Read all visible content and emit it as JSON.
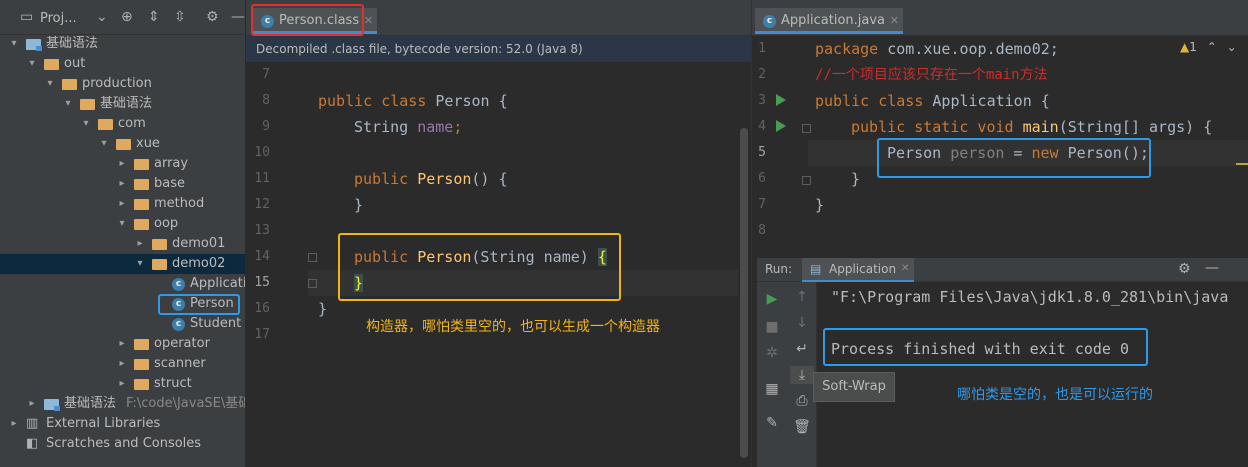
{
  "project_panel": {
    "title": "Proj...",
    "tree": [
      {
        "label": "基础语法",
        "icon": "module-folder-icon",
        "expanded": true
      },
      {
        "label": "out",
        "icon": "folder-icon",
        "expanded": true
      },
      {
        "label": "production",
        "icon": "folder-icon",
        "expanded": true
      },
      {
        "label": "基础语法",
        "icon": "folder-icon",
        "expanded": true
      },
      {
        "label": "com",
        "icon": "folder-icon",
        "expanded": true
      },
      {
        "label": "xue",
        "icon": "folder-icon",
        "expanded": true
      },
      {
        "label": "array",
        "icon": "folder-icon",
        "expanded": false
      },
      {
        "label": "base",
        "icon": "folder-icon",
        "expanded": false
      },
      {
        "label": "method",
        "icon": "folder-icon",
        "expanded": false
      },
      {
        "label": "oop",
        "icon": "folder-icon",
        "expanded": true
      },
      {
        "label": "demo01",
        "icon": "folder-icon",
        "expanded": false
      },
      {
        "label": "demo02",
        "icon": "folder-icon",
        "expanded": true
      },
      {
        "label": "Applicatio",
        "icon": "class-icon"
      },
      {
        "label": "Person",
        "icon": "class-icon"
      },
      {
        "label": "Student",
        "icon": "class-icon"
      },
      {
        "label": "operator",
        "icon": "folder-icon",
        "expanded": false
      },
      {
        "label": "scanner",
        "icon": "folder-icon",
        "expanded": false
      },
      {
        "label": "struct",
        "icon": "folder-icon",
        "expanded": false
      },
      {
        "label": "基础语法",
        "icon": "module-folder-icon",
        "expanded": false,
        "path": "F:\\code\\JavaSE\\基础语法"
      },
      {
        "label": "External Libraries",
        "icon": "library-icon",
        "expanded": false
      },
      {
        "label": "Scratches and Consoles",
        "icon": "scratch-icon"
      }
    ]
  },
  "editor_left": {
    "tab_label": "Person.class",
    "banner": "Decompiled .class file, bytecode version: 52.0 (Java 8)",
    "line_numbers": [
      "7",
      "8",
      "9",
      "10",
      "11",
      "12",
      "13",
      "14",
      "15",
      "16",
      "17"
    ],
    "code": {
      "l8_kw": "public class ",
      "l8_name": "Person {",
      "l9_type": "String ",
      "l9_field": "name",
      "l9_semi": ";",
      "l11_kw": "public ",
      "l11_fn": "Person",
      "l11_rest": "() {",
      "l12": "}",
      "l14_kw": "public ",
      "l14_fn": "Person",
      "l14_rest": "(String name) ",
      "l14_brace": "{",
      "l15_brace": "}",
      "l16": "}"
    },
    "annotation": "构造器，哪怕类里空的，也可以生成一个构造器"
  },
  "editor_right": {
    "tab_label": "Application.java",
    "warning_count": "1",
    "line_numbers": [
      "1",
      "2",
      "3",
      "4",
      "5",
      "6",
      "7",
      "8"
    ],
    "code": {
      "l1_kw": "package ",
      "l1_rest": "com.xue.oop.demo02;",
      "l2_comment": "//一个项目应该只存在一个main方法",
      "l3_kw": "public class ",
      "l3_rest": "Application {",
      "l4_kw": "public static void ",
      "l4_fn": "main",
      "l4_rest": "(String[] args) {",
      "l5_type": "Person ",
      "l5_var": "person",
      "l5_eq": " = ",
      "l5_kw": "new ",
      "l5_rest": "Person();",
      "l6": "}",
      "l7": "}"
    }
  },
  "run_panel": {
    "label": "Run:",
    "tab_label": "Application",
    "console_line1": "\"F:\\Program Files\\Java\\jdk1.8.0_281\\bin\\java",
    "console_line2": "Process finished with exit code 0",
    "tooltip": "Soft-Wrap",
    "annotation": "哪怕类是空的，也是可以运行的"
  },
  "colors": {
    "red_box": "#e03030",
    "yellow_box": "#f2b417",
    "blue_box": "#2f9ae8",
    "annotation_yellow": "#f2b417",
    "annotation_blue": "#2f9ae8"
  }
}
